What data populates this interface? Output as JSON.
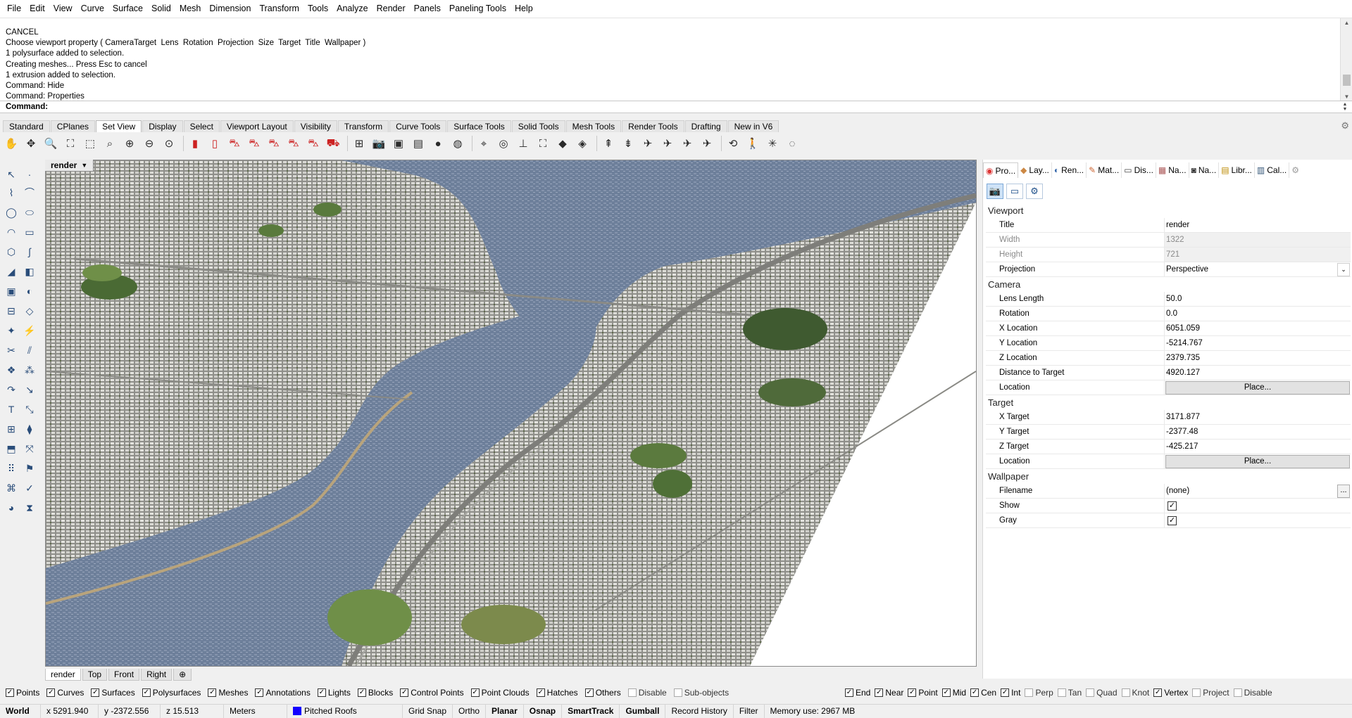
{
  "menu": [
    "File",
    "Edit",
    "View",
    "Curve",
    "Surface",
    "Solid",
    "Mesh",
    "Dimension",
    "Transform",
    "Tools",
    "Analyze",
    "Render",
    "Panels",
    "Paneling Tools",
    "Help"
  ],
  "history": [
    "CANCEL",
    "Choose viewport property ( CameraTarget  Lens  Rotation  Projection  Size  Target  Title  Wallpaper )",
    "1 polysurface added to selection.",
    "Creating meshes... Press Esc to cancel",
    "1 extrusion added to selection.",
    "Command: Hide",
    "Command: Properties"
  ],
  "command": {
    "label": "Command:",
    "value": ""
  },
  "toolbar_tabs": [
    "Standard",
    "CPlanes",
    "Set View",
    "Display",
    "Select",
    "Viewport Layout",
    "Visibility",
    "Transform",
    "Curve Tools",
    "Surface Tools",
    "Solid Tools",
    "Mesh Tools",
    "Render Tools",
    "Drafting",
    "New in V6"
  ],
  "active_toolbar_tab": "Set View",
  "viewport": {
    "title": "render"
  },
  "viewport_tabs": [
    "render",
    "Top",
    "Front",
    "Right"
  ],
  "panel_tabs": [
    {
      "icon": "properties-icon",
      "label": "Pro..."
    },
    {
      "icon": "layers-icon",
      "label": "Lay..."
    },
    {
      "icon": "render-icon",
      "label": "Ren..."
    },
    {
      "icon": "materials-icon",
      "label": "Mat..."
    },
    {
      "icon": "display-icon",
      "label": "Dis..."
    },
    {
      "icon": "named-cplanes-icon",
      "label": "Na..."
    },
    {
      "icon": "named-views-icon",
      "label": "Na..."
    },
    {
      "icon": "libraries-icon",
      "label": "Libr..."
    },
    {
      "icon": "calculator-icon",
      "label": "Cal..."
    }
  ],
  "props": {
    "sec_viewport": "Viewport",
    "title_k": "Title",
    "title_v": "render",
    "width_k": "Width",
    "width_v": "1322",
    "height_k": "Height",
    "height_v": "721",
    "projection_k": "Projection",
    "projection_v": "Perspective",
    "sec_camera": "Camera",
    "lens_k": "Lens Length",
    "lens_v": "50.0",
    "rotation_k": "Rotation",
    "rotation_v": "0.0",
    "xloc_k": "X Location",
    "xloc_v": "6051.059",
    "yloc_k": "Y Location",
    "yloc_v": "-5214.767",
    "zloc_k": "Z Location",
    "zloc_v": "2379.735",
    "dist_k": "Distance to Target",
    "dist_v": "4920.127",
    "camloc_k": "Location",
    "camloc_btn": "Place...",
    "sec_target": "Target",
    "xt_k": "X Target",
    "xt_v": "3171.877",
    "yt_k": "Y Target",
    "yt_v": "-2377.48",
    "zt_k": "Z Target",
    "zt_v": "-425.217",
    "tloc_k": "Location",
    "tloc_btn": "Place...",
    "sec_wallpaper": "Wallpaper",
    "file_k": "Filename",
    "file_v": "(none)",
    "file_btn": "...",
    "show_k": "Show",
    "show_v": true,
    "gray_k": "Gray",
    "gray_v": true
  },
  "filters": [
    {
      "label": "Points",
      "checked": true
    },
    {
      "label": "Curves",
      "checked": true
    },
    {
      "label": "Surfaces",
      "checked": true
    },
    {
      "label": "Polysurfaces",
      "checked": true
    },
    {
      "label": "Meshes",
      "checked": true
    },
    {
      "label": "Annotations",
      "checked": true
    },
    {
      "label": "Lights",
      "checked": true
    },
    {
      "label": "Blocks",
      "checked": true
    },
    {
      "label": "Control Points",
      "checked": true
    },
    {
      "label": "Point Clouds",
      "checked": true
    },
    {
      "label": "Hatches",
      "checked": true
    },
    {
      "label": "Others",
      "checked": true
    },
    {
      "label": "Disable",
      "checked": false
    },
    {
      "label": "Sub-objects",
      "checked": false
    }
  ],
  "osnaps": [
    {
      "label": "End",
      "checked": true
    },
    {
      "label": "Near",
      "checked": true
    },
    {
      "label": "Point",
      "checked": true
    },
    {
      "label": "Mid",
      "checked": true
    },
    {
      "label": "Cen",
      "checked": true
    },
    {
      "label": "Int",
      "checked": true
    },
    {
      "label": "Perp",
      "checked": false
    },
    {
      "label": "Tan",
      "checked": false
    },
    {
      "label": "Quad",
      "checked": false
    },
    {
      "label": "Knot",
      "checked": false
    },
    {
      "label": "Vertex",
      "checked": true
    },
    {
      "label": "Project",
      "checked": false
    },
    {
      "label": "Disable",
      "checked": false
    }
  ],
  "status": {
    "cplane": "World",
    "x": "x 5291.940",
    "y": "y -2372.556",
    "z": "z 15.513",
    "units": "Meters",
    "layer": "Pitched Roofs",
    "layer_color": "#1400ff",
    "grid_snap": "Grid Snap",
    "ortho": "Ortho",
    "planar": "Planar",
    "osnap": "Osnap",
    "smarttrack": "SmartTrack",
    "gumball": "Gumball",
    "record_history": "Record History",
    "filter": "Filter",
    "memory": "Memory use: 2967 MB"
  }
}
